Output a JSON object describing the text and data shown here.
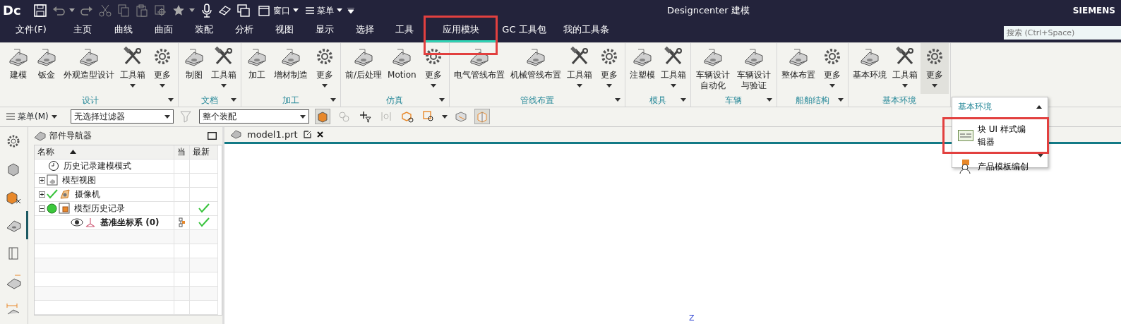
{
  "title_bar": {
    "logo": "Dc",
    "window_menu": "窗口",
    "menu": "菜单",
    "title": "Designcenter 建模",
    "brand": "SIEMENS"
  },
  "tabs": [
    {
      "label": "文件(F)",
      "selected": false,
      "highlighted": false
    },
    {
      "label": "主页",
      "selected": false,
      "highlighted": false
    },
    {
      "label": "曲线",
      "selected": false,
      "highlighted": false
    },
    {
      "label": "曲面",
      "selected": false,
      "highlighted": false
    },
    {
      "label": "装配",
      "selected": false,
      "highlighted": false
    },
    {
      "label": "分析",
      "selected": false,
      "highlighted": false
    },
    {
      "label": "视图",
      "selected": false,
      "highlighted": false
    },
    {
      "label": "显示",
      "selected": false,
      "highlighted": false
    },
    {
      "label": "选择",
      "selected": false,
      "highlighted": false
    },
    {
      "label": "工具",
      "selected": false,
      "highlighted": false
    },
    {
      "label": "应用模块",
      "selected": true,
      "highlighted": true
    },
    {
      "label": "GC 工具包",
      "selected": false,
      "highlighted": false
    },
    {
      "label": "我的工具条",
      "selected": false,
      "highlighted": false
    }
  ],
  "search": {
    "placeholder": "搜索 (Ctrl+Space)"
  },
  "ribbon_groups": [
    {
      "label": "设计",
      "launcher": true,
      "items": [
        {
          "label": "建模",
          "kind": "command",
          "expanded": false
        },
        {
          "label": "钣金",
          "kind": "command",
          "expanded": false
        },
        {
          "label": "外观造型设计",
          "kind": "command",
          "expanded": false
        },
        {
          "label": "工具箱",
          "kind": "toolbox",
          "expanded": false
        },
        {
          "label": "更多",
          "kind": "more",
          "expanded": false
        }
      ]
    },
    {
      "label": "文档",
      "launcher": true,
      "items": [
        {
          "label": "制图",
          "kind": "command",
          "expanded": false
        },
        {
          "label": "工具箱",
          "kind": "toolbox",
          "expanded": false
        }
      ]
    },
    {
      "label": "加工",
      "launcher": true,
      "items": [
        {
          "label": "加工",
          "kind": "command",
          "expanded": false
        },
        {
          "label": "增材制造",
          "kind": "command",
          "expanded": false
        },
        {
          "label": "更多",
          "kind": "more",
          "expanded": false
        }
      ]
    },
    {
      "label": "仿真",
      "launcher": true,
      "items": [
        {
          "label": "前/后处理",
          "kind": "command",
          "expanded": false
        },
        {
          "label": "Motion",
          "kind": "command",
          "expanded": false
        },
        {
          "label": "更多",
          "kind": "more",
          "expanded": false
        }
      ]
    },
    {
      "label": "管线布置",
      "launcher": true,
      "items": [
        {
          "label": "电气管线布置",
          "kind": "command",
          "expanded": false
        },
        {
          "label": "机械管线布置",
          "kind": "command",
          "expanded": false
        },
        {
          "label": "工具箱",
          "kind": "toolbox",
          "expanded": false
        },
        {
          "label": "更多",
          "kind": "more",
          "expanded": false
        }
      ]
    },
    {
      "label": "模具",
      "launcher": true,
      "items": [
        {
          "label": "注塑模",
          "kind": "command",
          "expanded": false
        },
        {
          "label": "工具箱",
          "kind": "toolbox",
          "expanded": false
        }
      ]
    },
    {
      "label": "车辆",
      "launcher": true,
      "items": [
        {
          "label": "车辆设计自动化",
          "kind": "command",
          "expanded": false
        },
        {
          "label": "车辆设计与验证",
          "kind": "command",
          "expanded": false
        }
      ]
    },
    {
      "label": "船舶结构",
      "launcher": true,
      "items": [
        {
          "label": "整体布置",
          "kind": "command",
          "expanded": false
        },
        {
          "label": "更多",
          "kind": "more",
          "expanded": false
        }
      ]
    },
    {
      "label": "基本环境",
      "launcher": false,
      "items": [
        {
          "label": "基本环境",
          "kind": "command",
          "expanded": false
        },
        {
          "label": "工具箱",
          "kind": "toolbox",
          "expanded": false
        },
        {
          "label": "更多",
          "kind": "more",
          "expanded": true
        }
      ]
    }
  ],
  "toolbar": {
    "menu": "菜单(M)",
    "selection_filter": "无选择过滤器",
    "assembly_scope": "整个装配",
    "toggles": [
      {
        "selected": true,
        "disabled": false
      },
      {
        "selected": false,
        "disabled": true
      },
      {
        "selected": false,
        "disabled": false
      },
      {
        "selected": false,
        "disabled": true
      },
      {
        "selected": false,
        "disabled": false
      },
      {
        "selected": false,
        "disabled": false
      },
      {
        "selected": false,
        "disabled": false
      },
      {
        "selected": true,
        "disabled": false
      }
    ]
  },
  "side_strip": [
    {
      "selected": false
    },
    {
      "selected": false
    },
    {
      "selected": false
    },
    {
      "selected": true
    },
    {
      "selected": false
    },
    {
      "selected": false
    },
    {
      "selected": false
    }
  ],
  "part_navigator": {
    "title": "部件导航器",
    "columns": [
      "名称",
      "当",
      "最新"
    ],
    "nodes": [
      {
        "label": "历史记录建模模式",
        "kind": "clock",
        "checked": false,
        "latest": false
      },
      {
        "label": "模型视图",
        "kind": "view",
        "expanded": false,
        "checked": false,
        "latest": false
      },
      {
        "label": "摄像机",
        "kind": "camera",
        "expanded": false,
        "checked": true,
        "latest": false
      },
      {
        "label": "模型历史记录",
        "kind": "history",
        "expanded": true,
        "checked": false,
        "latest": true,
        "children": [
          {
            "label": "基准坐标系 (0)",
            "kind": "datum",
            "checked": false,
            "active": true,
            "current": true,
            "latest": true
          }
        ]
      }
    ]
  },
  "document_tab": {
    "label": "model1.prt"
  },
  "graphics": {
    "axis_label": "Z"
  },
  "more_menu": {
    "header": "基本环境",
    "items": [
      {
        "label": "块 UI 样式编辑器",
        "highlighted": true
      },
      {
        "label": "产品模板编创",
        "highlighted": false
      }
    ]
  }
}
